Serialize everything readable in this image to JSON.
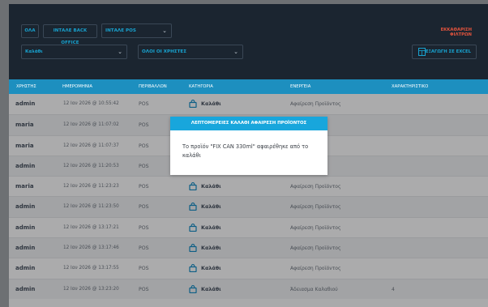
{
  "filters": {
    "buttons": [
      {
        "label": "ΟΛΑ"
      },
      {
        "label": "ΙΝΤΑΛΕ BACK OFFICE"
      },
      {
        "label": "ΙΝΤΑΛΕ POS"
      }
    ],
    "category_select": {
      "value": "Καλάθι"
    },
    "users_select": {
      "value": "ΟΛΟΙ ΟΙ ΧΡΗΣΤΕΣ"
    },
    "clear_label": "ΕΚΚΑΘΑΡΙΣΗ ΦΙΛΤΡΩΝ",
    "export_label": "ΕΞΑΓΩΓΗ ΣΕ EXCEL"
  },
  "table": {
    "columns": [
      "ΧΡΗΣΤΗΣ",
      "ΗΜΕΡΟΜΗΝΙΑ",
      "ΠΕΡΙΒΑΛΛΟΝ",
      "ΚΑΤΗΓΟΡΙΑ",
      "ΕΝΕΡΓΕΙΑ",
      "ΧΑΡΑΚΤΗΡΙΣΤΙΚΟ"
    ],
    "rows": [
      {
        "user": "admin",
        "date": "12 Ιαν 2026 @ 10:55:42",
        "env": "POS",
        "category": "Καλάθι",
        "action": "Αφαίρεση Προϊόντος",
        "feature": ""
      },
      {
        "user": "maria",
        "date": "12 Ιαν 2026 @ 11:07:02",
        "env": "POS",
        "category": "Καλάθι",
        "action": "",
        "feature": ""
      },
      {
        "user": "maria",
        "date": "12 Ιαν 2026 @ 11:07:37",
        "env": "POS",
        "category": "Καλάθι",
        "action": "",
        "feature": ""
      },
      {
        "user": "admin",
        "date": "12 Ιαν 2026 @ 11:20:53",
        "env": "POS",
        "category": "Καλάθι",
        "action": "",
        "feature": ""
      },
      {
        "user": "maria",
        "date": "12 Ιαν 2026 @ 11:23:23",
        "env": "POS",
        "category": "Καλάθι",
        "action": "Αφαίρεση Προϊόντος",
        "feature": ""
      },
      {
        "user": "admin",
        "date": "12 Ιαν 2026 @ 11:23:50",
        "env": "POS",
        "category": "Καλάθι",
        "action": "Αφαίρεση Προϊόντος",
        "feature": ""
      },
      {
        "user": "admin",
        "date": "12 Ιαν 2026 @ 13:17:21",
        "env": "POS",
        "category": "Καλάθι",
        "action": "Αφαίρεση Προϊόντος",
        "feature": ""
      },
      {
        "user": "admin",
        "date": "12 Ιαν 2026 @ 13:17:46",
        "env": "POS",
        "category": "Καλάθι",
        "action": "Αφαίρεση Προϊόντος",
        "feature": ""
      },
      {
        "user": "admin",
        "date": "12 Ιαν 2026 @ 13:17:55",
        "env": "POS",
        "category": "Καλάθι",
        "action": "Αφαίρεση Προϊόντος",
        "feature": ""
      },
      {
        "user": "admin",
        "date": "12 Ιαν 2026 @ 13:23:20",
        "env": "POS",
        "category": "Καλάθι",
        "action": "Άδειασμα Καλαθιού",
        "feature": "4"
      }
    ]
  },
  "modal": {
    "title": "ΛΕΠΤΟΜΕΡΕΙΕΣ ΚΑΛΑΘΙ ΑΦΑΙΡΕΣΗ ΠΡΟΪΟΝΤΟΣ",
    "message": "Το προϊόν \"FIX CAN 330ml\" αφαιρέθηκε από το καλάθι"
  },
  "icons": {
    "category": "shopping-bag-icon",
    "export": "spreadsheet-icon",
    "select": "chevron-down-icon"
  },
  "colors": {
    "accent": "#18a2cf",
    "header": "#1d8fbf",
    "danger": "#e0533d",
    "panel": "#1b2530"
  }
}
